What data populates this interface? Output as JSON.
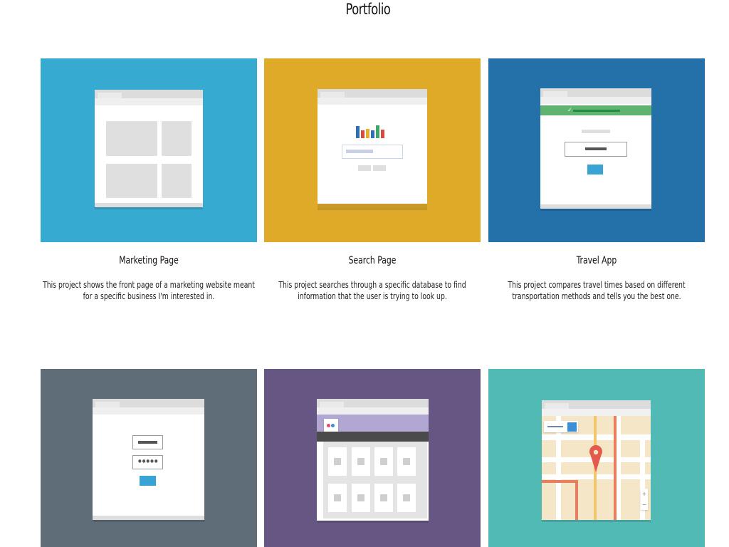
{
  "page": {
    "title": "Portfolio"
  },
  "projects": [
    {
      "title": "Marketing Page",
      "description": "This project shows the front page of a marketing website meant for a specific business I'm interested in.",
      "color": "#37aad1"
    },
    {
      "title": "Search Page",
      "description": "This project searches through a specific database to find information that the user is trying to look up.",
      "color": "#deaa28"
    },
    {
      "title": "Travel App",
      "description": "This project compares travel times based on different transportation methods and tells you the best one.",
      "color": "#2471a9"
    },
    {
      "title": "",
      "description": "",
      "color": "#5f6d78"
    },
    {
      "title": "",
      "description": "",
      "color": "#665683"
    },
    {
      "title": "",
      "description": "",
      "color": "#52bab4"
    }
  ],
  "thumbs": {
    "travel_check": "✓",
    "login_password": "●●●●●",
    "map_zoom_in": "+",
    "map_zoom_out": "−"
  }
}
